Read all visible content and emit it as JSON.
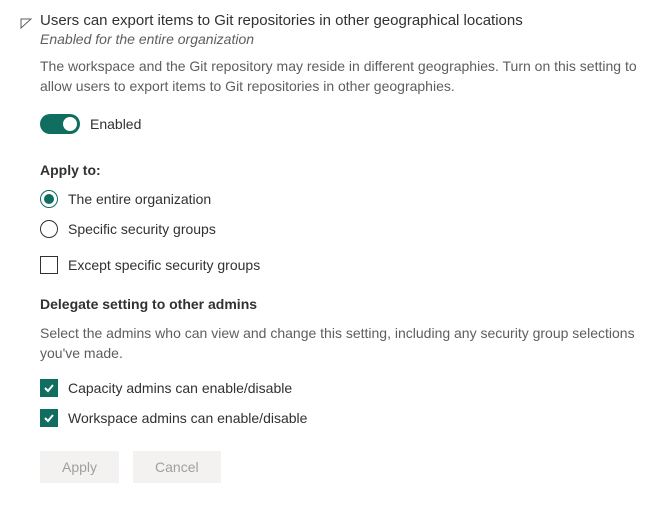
{
  "title": "Users can export items to Git repositories in other geographical locations",
  "subtitle": "Enabled for the entire organization",
  "description": "The workspace and the Git repository may reside in different geographies. Turn on this setting to allow users to export items to Git repositories in other geographies.",
  "toggle": {
    "label": "Enabled",
    "on": true
  },
  "apply": {
    "heading": "Apply to:",
    "options": {
      "entire_org": "The entire organization",
      "specific_groups": "Specific security groups"
    },
    "except_label": "Except specific security groups"
  },
  "delegate": {
    "heading": "Delegate setting to other admins",
    "description": "Select the admins who can view and change this setting, including any security group selections you've made.",
    "capacity_label": "Capacity admins can enable/disable",
    "workspace_label": "Workspace admins can enable/disable"
  },
  "buttons": {
    "apply": "Apply",
    "cancel": "Cancel"
  }
}
